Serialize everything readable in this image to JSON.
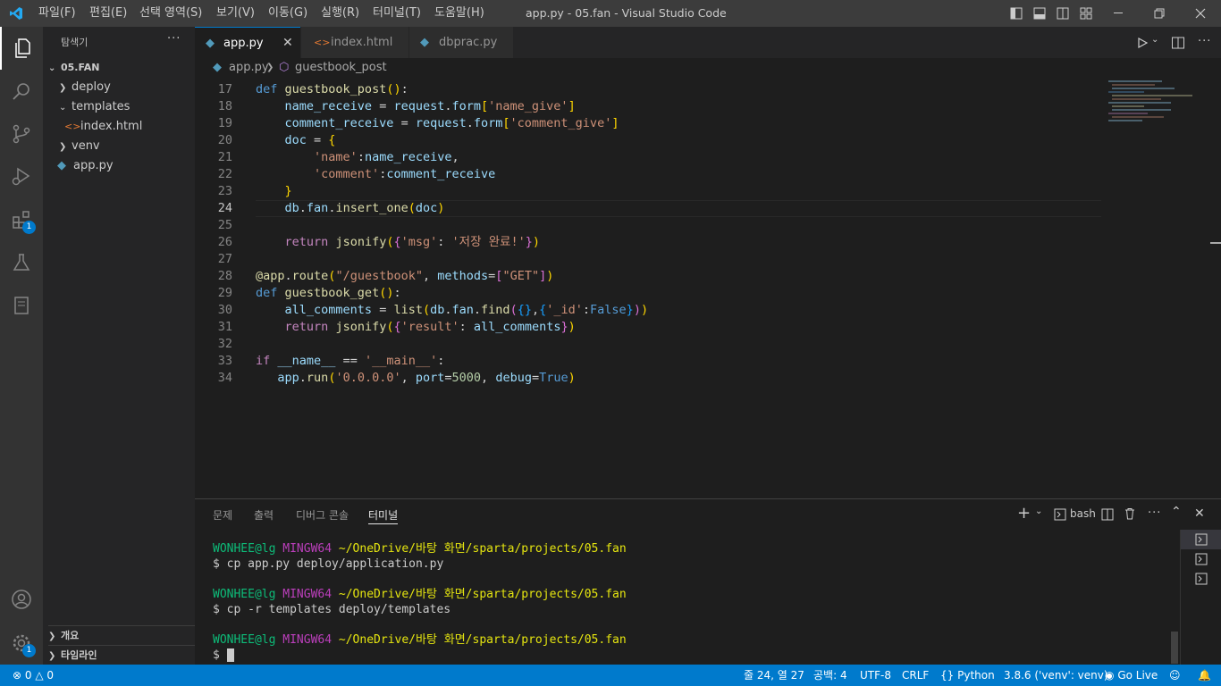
{
  "titlebar": {
    "menus": [
      "파일(F)",
      "편집(E)",
      "선택 영역(S)",
      "보기(V)",
      "이동(G)",
      "실행(R)",
      "터미널(T)",
      "도움말(H)"
    ],
    "title": "app.py - 05.fan - Visual Studio Code"
  },
  "activity": {
    "extensions_badge": "1",
    "settings_badge": "1"
  },
  "sidebar": {
    "header": "탐색기",
    "more": "···",
    "root": "05.FAN",
    "items": [
      "deploy",
      "templates",
      "index.html",
      "venv",
      "app.py"
    ],
    "outline": "개요",
    "timeline": "타임라인"
  },
  "tabs": [
    {
      "label": "app.py"
    },
    {
      "label": "index.html"
    },
    {
      "label": "dbprac.py"
    }
  ],
  "breadcrumb": {
    "file": "app.py",
    "symbol": "guestbook_post"
  },
  "editor": {
    "line_numbers": [
      "17",
      "18",
      "19",
      "20",
      "21",
      "22",
      "23",
      "24",
      "25",
      "26",
      "27",
      "28",
      "29",
      "30",
      "31",
      "32",
      "33",
      "34"
    ],
    "current_line": "24"
  },
  "panel": {
    "tabs": [
      "문제",
      "출력",
      "디버그 콘솔",
      "터미널"
    ],
    "active_tab": "터미널",
    "shell": "bash",
    "terminal": {
      "user": "WONHEE@lg",
      "host": "MINGW64",
      "path": "~/OneDrive/바탕 화면/sparta/projects/05.fan",
      "cmd1": "$ cp app.py deploy/application.py",
      "cmd2": "$ cp -r templates deploy/templates",
      "prompt": "$ "
    }
  },
  "statusbar": {
    "errors": "0",
    "warnings": "0",
    "position": "줄 24, 열 27",
    "spaces": "공백: 4",
    "encoding": "UTF-8",
    "eol": "CRLF",
    "language": "Python",
    "interpreter": "3.8.6 ('venv': venv)",
    "golive": "Go Live"
  },
  "colors": {
    "accent": "#007acc",
    "titlebar": "#3c3c3c",
    "sidebar": "#252526",
    "editor": "#1e1e1e"
  }
}
